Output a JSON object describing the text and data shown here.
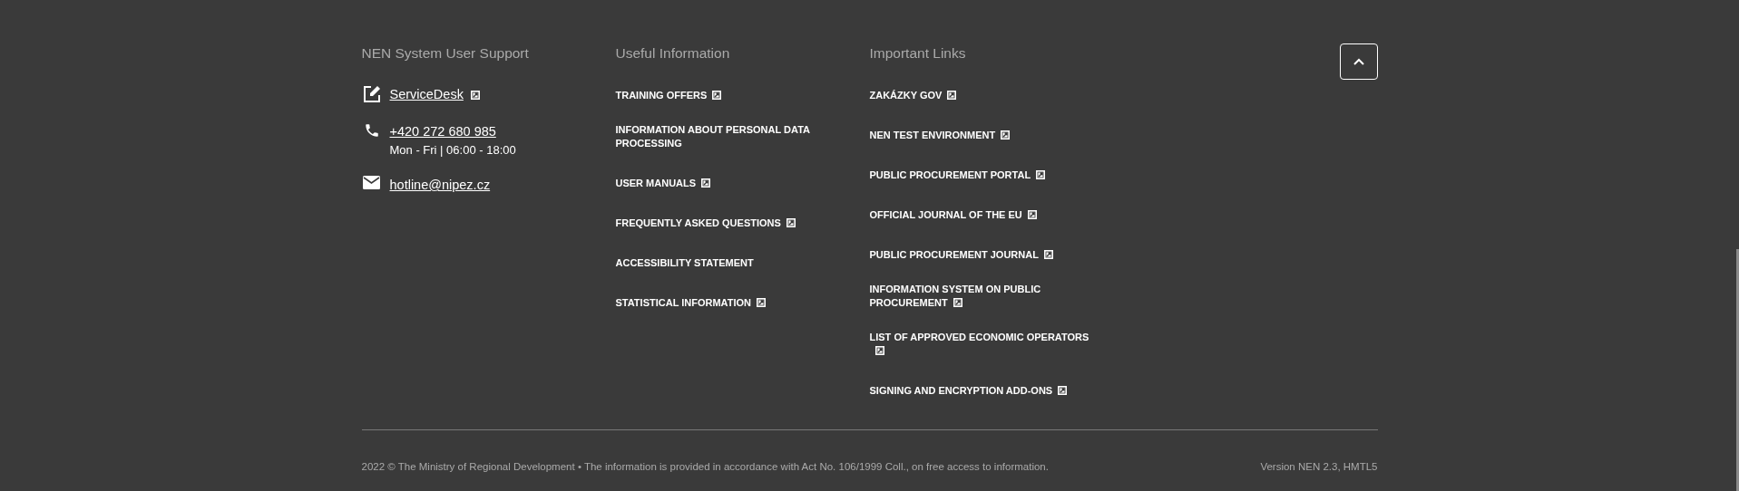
{
  "support": {
    "title": "NEN System User Support",
    "items": [
      {
        "kind": "edit",
        "link": "ServiceDesk",
        "external": true
      },
      {
        "kind": "phone",
        "link": "+420 272 680 985",
        "note": "Mon - Fri | 06:00 - 18:00",
        "external": false
      },
      {
        "kind": "email",
        "link": "hotline@nipez.cz",
        "external": false
      }
    ]
  },
  "useful": {
    "title": "Useful Information",
    "links": [
      {
        "label": "TRAINING OFFERS",
        "external": true
      },
      {
        "label": "INFORMATION ABOUT PERSONAL DATA PROCESSING",
        "external": false
      },
      {
        "label": "USER MANUALS",
        "external": true
      },
      {
        "label": "FREQUENTLY ASKED QUESTIONS",
        "external": true
      },
      {
        "label": "ACCESSIBILITY STATEMENT",
        "external": false
      },
      {
        "label": "STATISTICAL INFORMATION",
        "external": true
      }
    ]
  },
  "important": {
    "title": "Important Links",
    "links": [
      {
        "label": "ZAKÁZKY GOV",
        "external": true
      },
      {
        "label": "NEN TEST ENVIRONMENT",
        "external": true
      },
      {
        "label": "PUBLIC PROCUREMENT PORTAL",
        "external": true
      },
      {
        "label": "OFFICIAL JOURNAL OF THE EU",
        "external": true
      },
      {
        "label": "PUBLIC PROCUREMENT JOURNAL",
        "external": true
      },
      {
        "label": "INFORMATION SYSTEM ON PUBLIC PROCUREMENT",
        "external": true
      },
      {
        "label": "LIST OF APPROVED ECONOMIC OPERATORS",
        "external": true
      },
      {
        "label": "SIGNING AND ENCRYPTION ADD-ONS",
        "external": true
      }
    ]
  },
  "copyright": "2022 © The Ministry of Regional Development • The information is provided in accordance with Act No. 106/1999 Coll., on free access to information.",
  "version": "Version NEN 2.3, HMTL5"
}
